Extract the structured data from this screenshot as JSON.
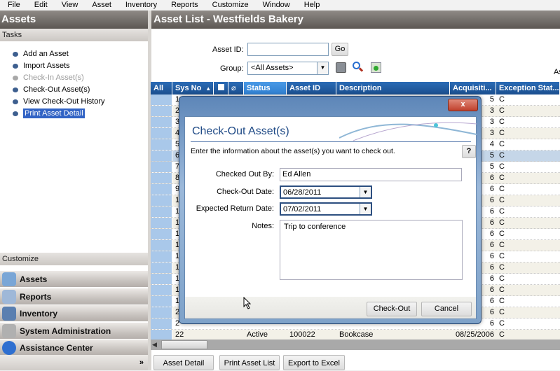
{
  "menu": [
    "File",
    "Edit",
    "View",
    "Asset",
    "Inventory",
    "Reports",
    "Customize",
    "Window",
    "Help"
  ],
  "left": {
    "title": "Assets",
    "tasks_header": "Tasks",
    "tasks": [
      {
        "label": "Add an Asset",
        "state": "enabled"
      },
      {
        "label": "Import Assets",
        "state": "enabled"
      },
      {
        "label": "Check-In Asset(s)",
        "state": "disabled"
      },
      {
        "label": "Check-Out Asset(s)",
        "state": "enabled"
      },
      {
        "label": "View Check-Out History",
        "state": "enabled"
      },
      {
        "label": "Print Asset Detail",
        "state": "selected"
      }
    ],
    "customize_header": "Customize",
    "nav": [
      {
        "label": "Assets",
        "icon": "tag-icon"
      },
      {
        "label": "Reports",
        "icon": "report-icon"
      },
      {
        "label": "Inventory",
        "icon": "scanner-icon"
      },
      {
        "label": "System Administration",
        "icon": "gear-icon"
      },
      {
        "label": "Assistance Center",
        "icon": "help-icon"
      }
    ],
    "more": "»"
  },
  "main": {
    "title": "Asset List - Westfields Bakery",
    "asset_id_label": "Asset ID:",
    "asset_id_value": "",
    "go": "Go",
    "group_label": "Group:",
    "group_value": "<All Assets>",
    "right_clip": "As",
    "columns": [
      "All",
      "Sys No",
      "",
      "",
      "Status",
      "Asset ID",
      "Description",
      "Acquisiti...",
      "Exception Stat..."
    ],
    "rows": [
      {
        "sys": "1",
        "acq": "5",
        "exc": "C"
      },
      {
        "sys": "2",
        "acq": "3",
        "exc": "C"
      },
      {
        "sys": "3",
        "acq": "3",
        "exc": "C"
      },
      {
        "sys": "4",
        "acq": "3",
        "exc": "C"
      },
      {
        "sys": "5",
        "acq": "4",
        "exc": "C"
      },
      {
        "sys": "6",
        "acq": "5",
        "exc": "C",
        "selected": true
      },
      {
        "sys": "7",
        "acq": "5",
        "exc": "C"
      },
      {
        "sys": "8",
        "acq": "6",
        "exc": "C"
      },
      {
        "sys": "9",
        "acq": "6",
        "exc": "C"
      },
      {
        "sys": "1",
        "acq": "6",
        "exc": "C"
      },
      {
        "sys": "1",
        "acq": "6",
        "exc": "C"
      },
      {
        "sys": "1",
        "acq": "6",
        "exc": "C"
      },
      {
        "sys": "1",
        "acq": "6",
        "exc": "C"
      },
      {
        "sys": "1",
        "acq": "6",
        "exc": "C"
      },
      {
        "sys": "1",
        "acq": "6",
        "exc": "C"
      },
      {
        "sys": "1",
        "acq": "6",
        "exc": "C"
      },
      {
        "sys": "1",
        "acq": "6",
        "exc": "C"
      },
      {
        "sys": "1",
        "acq": "6",
        "exc": "C"
      },
      {
        "sys": "1",
        "acq": "6",
        "exc": "C"
      },
      {
        "sys": "2",
        "acq": "6",
        "exc": "C"
      },
      {
        "sys": "2",
        "acq": "6",
        "exc": "C"
      },
      {
        "sys": "22",
        "status": "Active",
        "asset_id": "100022",
        "desc": "Bookcase",
        "acq": "08/25/2006",
        "exc": "C"
      }
    ],
    "buttons": [
      "Asset Detail",
      "Print Asset List",
      "Export to Excel"
    ]
  },
  "dialog": {
    "close": "x",
    "title": "Check-Out Asset(s)",
    "instruction": "Enter the information about the asset(s) you want to check out.",
    "help": "?",
    "checked_out_by_label": "Checked Out By:",
    "checked_out_by": "Ed Allen",
    "checkout_date_label": "Check-Out Date:",
    "checkout_date": "06/28/2011",
    "return_date_label": "Expected Return Date:",
    "return_date": "07/02/2011",
    "notes_label": "Notes:",
    "notes": "Trip to conference",
    "checkout_btn": "Check-Out",
    "cancel_btn": "Cancel"
  }
}
